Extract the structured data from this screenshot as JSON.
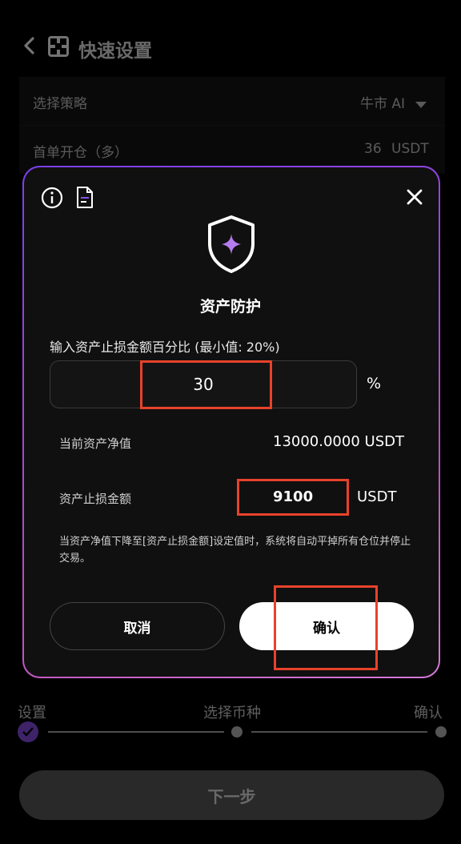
{
  "header": {
    "title": "快速设置"
  },
  "settings": {
    "strategy_label": "选择策略",
    "strategy_value": "牛市 AI",
    "first_order_label": "首单开仓（多）",
    "first_order_value": "36",
    "first_order_unit": "USDT"
  },
  "modal": {
    "title": "资产防护",
    "prompt": "输入资产止损金额百分比 (最小值: 20%)",
    "percent_value": "30",
    "percent_unit": "%",
    "nav_label": "当前资产净值",
    "nav_value": "13000.0000 USDT",
    "stop_label": "资产止损金额",
    "stop_value": "9100",
    "stop_unit": "USDT",
    "note": "当资产净值下降至[资产止损金额]设定值时，系统将自动平掉所有仓位并停止交易。",
    "cancel_label": "取消",
    "confirm_label": "确认"
  },
  "steps": {
    "step1": "设置",
    "step2": "选择币种",
    "step3": "确认",
    "current_step": 1
  },
  "footer": {
    "next_label": "下一步"
  },
  "colors": {
    "accent": "#8a4fe8",
    "highlight": "#e8422b"
  },
  "icons": [
    "chevron-left-icon",
    "logo-icon",
    "info-icon",
    "document-icon",
    "close-icon",
    "shield-sparkle-icon",
    "check-icon"
  ]
}
